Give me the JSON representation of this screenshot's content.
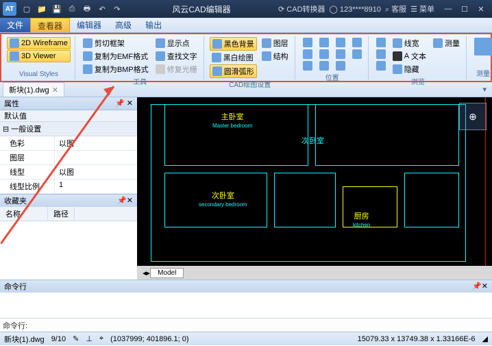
{
  "title": "风云CAD编辑器",
  "title_right": {
    "converter": "CAD转换器",
    "user": "123****8910",
    "service": "客服",
    "menu": "菜单"
  },
  "menu": {
    "file": "文件",
    "viewer": "查看器",
    "editor": "编辑器",
    "advanced": "高级",
    "output": "输出"
  },
  "ribbon": {
    "visual": {
      "wire": "2D Wireframe",
      "viewer": "3D Viewer",
      "label": "Visual Styles"
    },
    "tools": {
      "cut": "剪切框架",
      "emf": "复制为EMF格式",
      "bmp": "复制为BMP格式",
      "mark": "显示点",
      "find": "查找文字",
      "repair": "修复光栅",
      "label": "工具"
    },
    "drawset": {
      "blackbg": "黑色背景",
      "bwdraw": "黑白绘图",
      "smooth": "圆滑弧形",
      "layer": "图层",
      "struct": "结构",
      "label": "CAD绘图设置"
    },
    "pos": {
      "label": "位置"
    },
    "browse": {
      "linew": "线宽",
      "measure": "测量",
      "text": "文本",
      "hide": "隐藏",
      "label": "浏览"
    },
    "measure": {
      "label": "测量"
    }
  },
  "doc": {
    "name": "新块(1).dwg"
  },
  "props": {
    "title": "属性",
    "default": "默认值",
    "general": "一般设置",
    "rows": [
      [
        "色彩",
        "以图"
      ],
      [
        "图层",
        ""
      ],
      [
        "线型",
        "以图"
      ],
      [
        "线型比例",
        "1"
      ]
    ]
  },
  "fav": {
    "title": "收藏夹",
    "name": "名称",
    "path": "路径"
  },
  "rooms": {
    "master": "主卧室",
    "master_en": "Master bedroom",
    "sec": "次卧室",
    "sec_en": "secondary bedroom",
    "kitchen": "厨房",
    "kitchen_en": "kitchen"
  },
  "model_tab": "Model",
  "cmd": {
    "label": "命令行",
    "prompt": "命令行:"
  },
  "status": {
    "doc": "新块(1).dwg",
    "ratio": "9/10",
    "coords": "(1037999; 401896.1; 0)",
    "dims": "15079.33 x 13749.38 x 1.33166E-6"
  }
}
